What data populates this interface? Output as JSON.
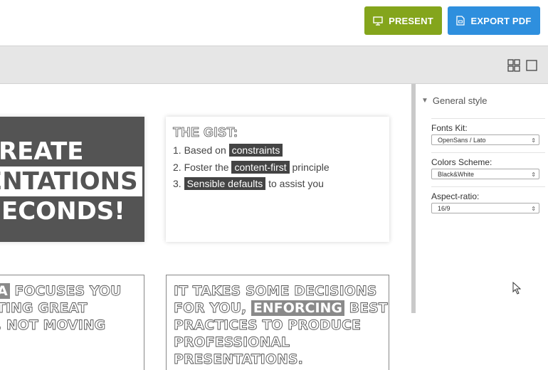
{
  "topbar": {
    "present_label": "PRESENT",
    "export_label": "EXPORT PDF",
    "present_color": "#84a51c",
    "export_color": "#2e8fde"
  },
  "slides": {
    "title_slide": {
      "line1": "REATE",
      "line2": "ENTATIONS",
      "line3": "ECONDS!"
    },
    "gist_slide": {
      "title": "THE GIST:",
      "items": [
        {
          "prefix": "1. Based on ",
          "highlight": "constraints",
          "suffix": ""
        },
        {
          "prefix": "2. Foster the ",
          "highlight": "content-first",
          "suffix": " principle"
        },
        {
          "prefix": "3. ",
          "highlight": "Sensible defaults",
          "suffix": " to assist you"
        }
      ]
    },
    "focus_slide": {
      "line1_hl": "A",
      "line1": " FOCUSES YOU",
      "line2": "TING GREAT",
      "line3": ", NOT MOVING"
    },
    "takes_slide": {
      "line1": "IT TAKES SOME DECISIONS",
      "line2_pre": "FOR YOU, ",
      "line2_hl": "ENFORCING",
      "line2_post": " BEST",
      "line3": "PRACTICES TO PRODUCE",
      "line4": "PROFESSIONAL",
      "line5": "PRESENTATIONS."
    }
  },
  "panel": {
    "header": "General style",
    "fonts_label": "Fonts Kit:",
    "fonts_value": "OpenSans / Lato",
    "colors_label": "Colors Scheme:",
    "colors_value": "Black&White",
    "ratio_label": "Aspect-ratio:",
    "ratio_value": "16/9"
  }
}
